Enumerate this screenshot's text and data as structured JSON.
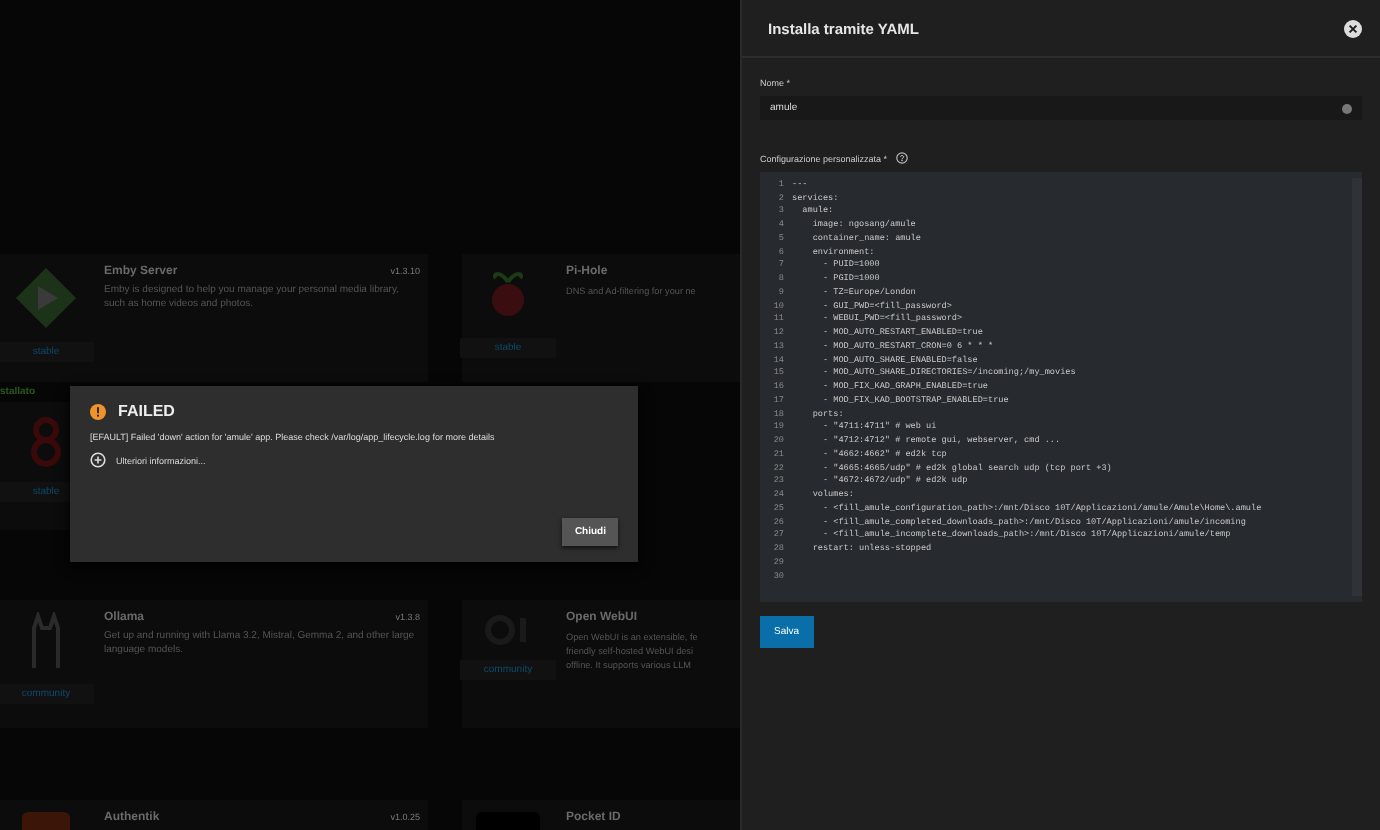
{
  "background_apps": {
    "rows": [
      {
        "cards": [
          {
            "title": "Emby Server",
            "version": "v1.3.10",
            "description": "Emby is designed to help you manage your personal media library, such as home videos and photos.",
            "train": "stable"
          },
          {
            "title": "Pi-Hole",
            "description": [
              "DNS and Ad-filtering for your ne"
            ],
            "train": "stable"
          }
        ]
      },
      {
        "status": "stallato",
        "cards": [
          {
            "train": "stable"
          }
        ]
      },
      {
        "cards": [
          {
            "title": "Ollama",
            "version": "v1.3.8",
            "description": "Get up and running with Llama 3.2, Mistral, Gemma 2, and other large language models.",
            "train": "community"
          },
          {
            "title": "Open WebUI",
            "description": [
              "Open WebUI is an extensible, fe",
              "friendly self-hosted WebUI desi",
              "offline. It supports various LLM"
            ],
            "train": "community"
          }
        ]
      },
      {
        "cards": [
          {
            "title": "Authentik",
            "version": "v1.0.25"
          },
          {
            "title": "Pocket ID"
          }
        ]
      }
    ]
  },
  "error_dialog": {
    "title": "FAILED",
    "message": "[EFAULT] Failed 'down' action for 'amule' app. Please check /var/log/app_lifecycle.log for more details",
    "more_info": "Ulteriori informazioni...",
    "expanded": false,
    "close_button": "Chiudi"
  },
  "panel": {
    "title": "Installa tramite YAML",
    "name_field": {
      "label": "Nome *",
      "value": "amule"
    },
    "config_field": {
      "label": "Configurazione personalizzata *",
      "lines": [
        {
          "number": "1",
          "text": "---"
        },
        {
          "number": "2",
          "text": "services:"
        },
        {
          "number": "3",
          "text": "  amule:"
        },
        {
          "number": "4",
          "text": "    image: ngosang/amule"
        },
        {
          "number": "5",
          "text": "    container_name: amule"
        },
        {
          "number": "6",
          "text": "    environment:"
        },
        {
          "number": "7",
          "text": "      - PUID=1000"
        },
        {
          "number": "8",
          "text": "      - PGID=1000"
        },
        {
          "number": "9",
          "text": "      - TZ=Europe/London"
        },
        {
          "number": "10",
          "text": "      - GUI_PWD=<fill_password>"
        },
        {
          "number": "11",
          "text": "      - WEBUI_PWD=<fill_password>"
        },
        {
          "number": "12",
          "text": "      - MOD_AUTO_RESTART_ENABLED=true"
        },
        {
          "number": "13",
          "text": "      - MOD_AUTO_RESTART_CRON=0 6 * * *"
        },
        {
          "number": "14",
          "text": "      - MOD_AUTO_SHARE_ENABLED=false"
        },
        {
          "number": "15",
          "text": "      - MOD_AUTO_SHARE_DIRECTORIES=/incoming;/my_movies"
        },
        {
          "number": "16",
          "text": "      - MOD_FIX_KAD_GRAPH_ENABLED=true"
        },
        {
          "number": "17",
          "text": "      - MOD_FIX_KAD_BOOTSTRAP_ENABLED=true"
        },
        {
          "number": "18",
          "text": "    ports:"
        },
        {
          "number": "19",
          "text": "      - \"4711:4711\" # web ui"
        },
        {
          "number": "20",
          "text": "      - \"4712:4712\" # remote gui, webserver, cmd ..."
        },
        {
          "number": "21",
          "text": "      - \"4662:4662\" # ed2k tcp"
        },
        {
          "number": "22",
          "text": "      - \"4665:4665/udp\" # ed2k global search udp (tcp port +3)"
        },
        {
          "number": "23",
          "text": "      - \"4672:4672/udp\" # ed2k udp"
        },
        {
          "number": "24",
          "text": "    volumes:"
        },
        {
          "number": "25",
          "text": "      - <fill_amule_configuration_path>:/mnt/Disco 10T/Applicazioni/amule/Amule\\Home\\.amule"
        },
        {
          "number": "26",
          "text": "      - <fill_amule_completed_downloads_path>:/mnt/Disco 10T/Applicazioni/amule/incoming"
        },
        {
          "number": "27",
          "text": "      - <fill_amule_incomplete_downloads_path>:/mnt/Disco 10T/Applicazioni/amule/temp"
        },
        {
          "number": "28",
          "text": "    restart: unless-stopped"
        },
        {
          "number": "29"
        },
        {
          "number": "30"
        }
      ]
    },
    "save_button": "Salva"
  }
}
